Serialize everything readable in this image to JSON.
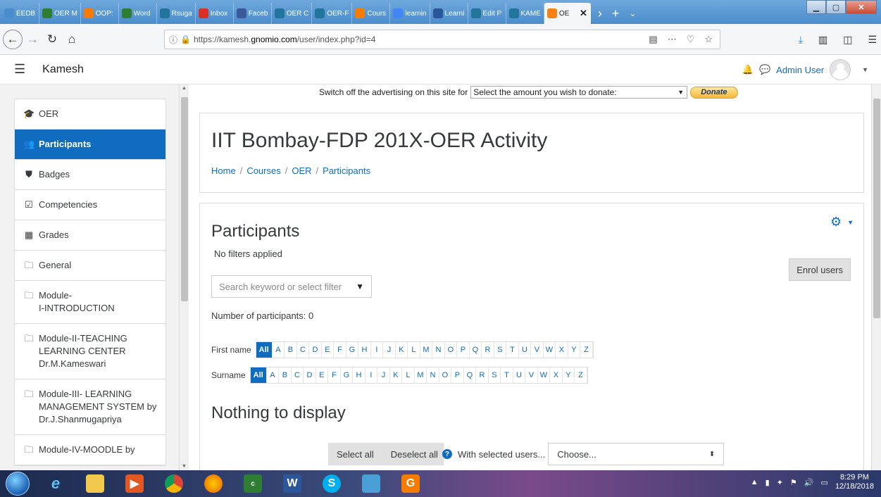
{
  "browser": {
    "tabs": [
      {
        "label": "EEDB",
        "icon": "back-arrow-icon",
        "color": "#4a8ccc"
      },
      {
        "label": "OER M",
        "icon": "table-icon",
        "color": "#2e7d32"
      },
      {
        "label": "OOP:",
        "icon": "in-icon",
        "color": "#f57c00"
      },
      {
        "label": "Word",
        "icon": "table-icon",
        "color": "#2e7d32"
      },
      {
        "label": "Rsuga",
        "icon": "wordpress-icon",
        "color": "#21759b"
      },
      {
        "label": "Inbox",
        "icon": "gmail-icon",
        "color": "#d93025"
      },
      {
        "label": "Faceb",
        "icon": "facebook-icon",
        "color": "#3b5998"
      },
      {
        "label": "OER C",
        "icon": "wordpress-icon",
        "color": "#21759b"
      },
      {
        "label": "OER-F",
        "icon": "wordpress-icon",
        "color": "#21759b"
      },
      {
        "label": "Cours",
        "icon": "in-icon",
        "color": "#f57c00"
      },
      {
        "label": "learnin",
        "icon": "google-icon",
        "color": "#4285f4"
      },
      {
        "label": "Learni",
        "icon": "word-icon",
        "color": "#2b579a"
      },
      {
        "label": "Edit P",
        "icon": "wordpress-icon",
        "color": "#21759b"
      },
      {
        "label": "KAME",
        "icon": "wordpress-icon",
        "color": "#21759b"
      },
      {
        "label": "OE",
        "icon": "moodle-icon",
        "color": "#f98012",
        "active": true
      }
    ],
    "tab_close": "✕",
    "new_tab": "+",
    "url": {
      "prefix": "https://kamesh.",
      "host": "gnomio.com",
      "path": "/user/index.php?id=4"
    }
  },
  "moodle": {
    "site_name": "Kamesh",
    "user_name": "Admin User"
  },
  "sidebar": {
    "items": [
      {
        "label": "OER",
        "icon": "graduation-cap-icon",
        "glyph": "🎓"
      },
      {
        "label": "Participants",
        "icon": "users-icon",
        "glyph": "👥",
        "active": true
      },
      {
        "label": "Badges",
        "icon": "shield-icon",
        "glyph": "⛊"
      },
      {
        "label": "Competencies",
        "icon": "checkbox-icon",
        "glyph": "☑"
      },
      {
        "label": "Grades",
        "icon": "table-icon",
        "glyph": "▦"
      },
      {
        "label": "General",
        "icon": "folder-icon",
        "glyph": "🗀"
      },
      {
        "label": "Module-\nI-INTRODUCTION",
        "icon": "folder-icon",
        "glyph": "🗀"
      },
      {
        "label": "Module-II-TEACHING LEARNING CENTER Dr.M.Kameswari",
        "icon": "folder-icon",
        "glyph": "🗀"
      },
      {
        "label": "Module-III- LEARNING MANAGEMENT SYSTEM by Dr.J.Shanmugapriya",
        "icon": "folder-icon",
        "glyph": "🗀"
      },
      {
        "label": "Module-IV-MOODLE by",
        "icon": "folder-icon",
        "glyph": "🗀"
      }
    ]
  },
  "donation": {
    "text": "Switch off the advertising on this site for",
    "select_value": "Select the amount you wish to donate:",
    "button": "Donate"
  },
  "course": {
    "title": "IIT Bombay-FDP 201X-OER Activity",
    "breadcrumb": [
      "Home",
      "Courses",
      "OER",
      "Participants"
    ]
  },
  "participants": {
    "heading": "Participants",
    "filter_status": "No filters applied",
    "enrol_button": "Enrol users",
    "search_placeholder": "Search keyword or select filter",
    "count_text": "Number of participants: 0",
    "first_name_label": "First name",
    "surname_label": "Surname",
    "all_label": "All",
    "letters": [
      "A",
      "B",
      "C",
      "D",
      "E",
      "F",
      "G",
      "H",
      "I",
      "J",
      "K",
      "L",
      "M",
      "N",
      "O",
      "P",
      "Q",
      "R",
      "S",
      "T",
      "U",
      "V",
      "W",
      "X",
      "Y",
      "Z"
    ],
    "empty_message": "Nothing to display",
    "select_all": "Select all",
    "deselect_all": "Deselect all",
    "with_selected": "With selected users...",
    "choose": "Choose..."
  },
  "taskbar": {
    "time": "8:29 PM",
    "date": "12/18/2018"
  }
}
